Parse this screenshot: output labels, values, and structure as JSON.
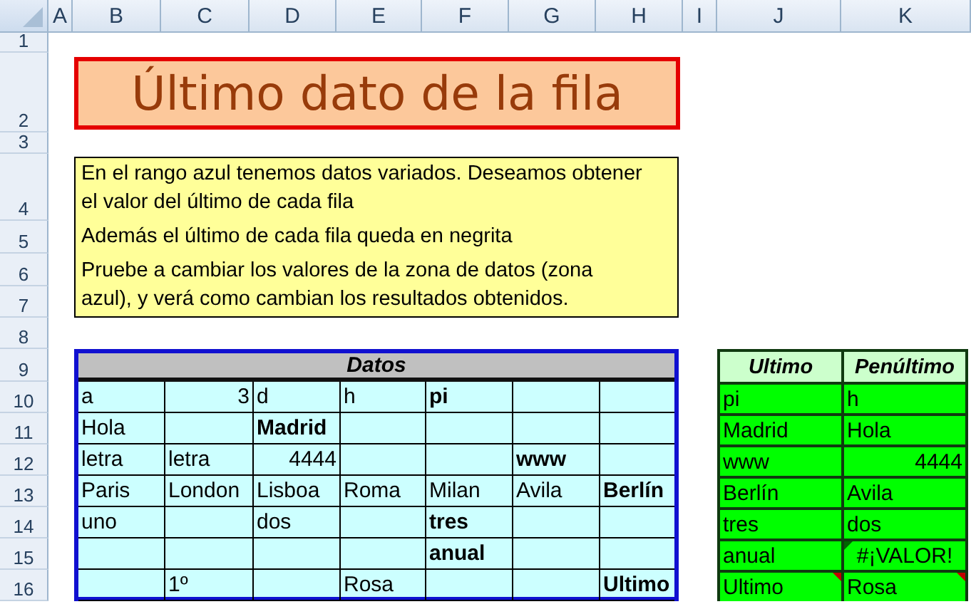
{
  "columns": [
    "A",
    "B",
    "C",
    "D",
    "E",
    "F",
    "G",
    "H",
    "I",
    "J",
    "K"
  ],
  "rows": [
    "1",
    "2",
    "3",
    "4",
    "5",
    "6",
    "7",
    "8",
    "9",
    "10",
    "11",
    "12",
    "13",
    "14",
    "15",
    "16"
  ],
  "title": "Último dato de la fila",
  "note": [
    "En el rango azul tenemos datos variados. Deseamos obtener el valor del último de cada fila",
    "Además el último de cada fila queda en negrita",
    "Pruebe a cambiar los valores de la zona de datos (zona azul), y verá como cambian los resultados obtenidos."
  ],
  "data_table": {
    "title": "Datos",
    "rows": [
      [
        {
          "text": "a",
          "bold": false,
          "numeric": false
        },
        {
          "text": "3",
          "bold": false,
          "numeric": true
        },
        {
          "text": "d",
          "bold": false,
          "numeric": false
        },
        {
          "text": "h",
          "bold": false,
          "numeric": false
        },
        {
          "text": "pi",
          "bold": true,
          "numeric": false
        },
        {},
        {}
      ],
      [
        {
          "text": "Hola",
          "bold": false,
          "numeric": false
        },
        {},
        {
          "text": "Madrid",
          "bold": true,
          "numeric": false
        },
        {},
        {},
        {},
        {}
      ],
      [
        {
          "text": "letra",
          "bold": false,
          "numeric": false
        },
        {
          "text": "letra",
          "bold": false,
          "numeric": false
        },
        {
          "text": "4444",
          "bold": false,
          "numeric": true
        },
        {},
        {},
        {
          "text": "www",
          "bold": true,
          "numeric": false
        },
        {}
      ],
      [
        {
          "text": "Paris",
          "bold": false,
          "numeric": false
        },
        {
          "text": "London",
          "bold": false,
          "numeric": false
        },
        {
          "text": "Lisboa",
          "bold": false,
          "numeric": false
        },
        {
          "text": "Roma",
          "bold": false,
          "numeric": false
        },
        {
          "text": "Milan",
          "bold": false,
          "numeric": false
        },
        {
          "text": "Avila",
          "bold": false,
          "numeric": false
        },
        {
          "text": "Berlín",
          "bold": true,
          "numeric": false
        }
      ],
      [
        {
          "text": "uno",
          "bold": false,
          "numeric": false
        },
        {},
        {
          "text": "dos",
          "bold": false,
          "numeric": false
        },
        {},
        {
          "text": "tres",
          "bold": true,
          "numeric": false
        },
        {},
        {}
      ],
      [
        {},
        {},
        {},
        {},
        {
          "text": "anual",
          "bold": true,
          "numeric": false
        },
        {},
        {}
      ],
      [
        {},
        {
          "text": "1º",
          "bold": false,
          "numeric": false
        },
        {},
        {
          "text": "Rosa",
          "bold": false,
          "numeric": false
        },
        {},
        {},
        {
          "text": "Ultimo",
          "bold": true,
          "numeric": false
        }
      ]
    ]
  },
  "results_table": {
    "headers": [
      "Ultimo",
      "Penúltimo"
    ],
    "rows": [
      [
        {
          "text": "pi",
          "numeric": false,
          "comment": false,
          "error_flag": false
        },
        {
          "text": "h",
          "numeric": false,
          "comment": false,
          "error_flag": false
        }
      ],
      [
        {
          "text": "Madrid",
          "numeric": false,
          "comment": false,
          "error_flag": false
        },
        {
          "text": "Hola",
          "numeric": false,
          "comment": false,
          "error_flag": false
        }
      ],
      [
        {
          "text": "www",
          "numeric": false,
          "comment": false,
          "error_flag": false
        },
        {
          "text": "4444",
          "numeric": true,
          "comment": false,
          "error_flag": false
        }
      ],
      [
        {
          "text": "Berlín",
          "numeric": false,
          "comment": false,
          "error_flag": false
        },
        {
          "text": "Avila",
          "numeric": false,
          "comment": false,
          "error_flag": false
        }
      ],
      [
        {
          "text": "tres",
          "numeric": false,
          "comment": false,
          "error_flag": false
        },
        {
          "text": "dos",
          "numeric": false,
          "comment": false,
          "error_flag": false
        }
      ],
      [
        {
          "text": "anual",
          "numeric": false,
          "comment": false,
          "error_flag": false
        },
        {
          "text": "#¡VALOR!",
          "numeric": false,
          "comment": false,
          "error_flag": true
        }
      ],
      [
        {
          "text": "Ultimo",
          "numeric": false,
          "comment": true,
          "error_flag": false
        },
        {
          "text": "Rosa",
          "numeric": false,
          "comment": true,
          "error_flag": false
        }
      ]
    ]
  }
}
